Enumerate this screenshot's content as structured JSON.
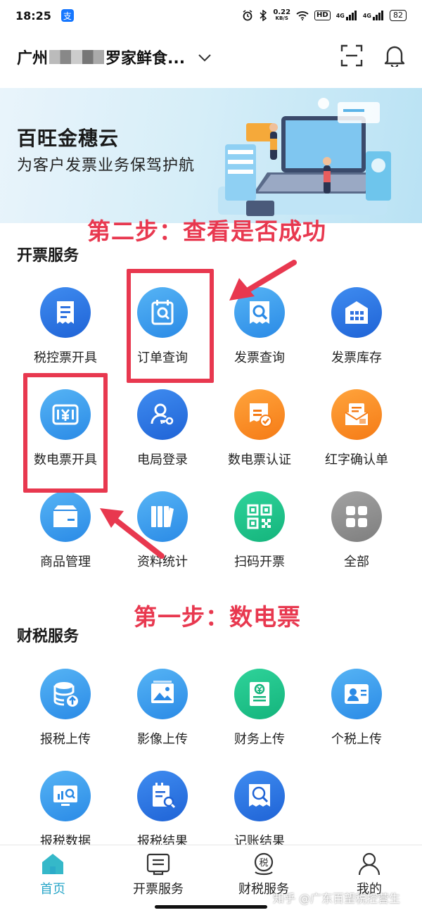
{
  "status_bar": {
    "time": "18:25",
    "app_badge": "支",
    "speed_value": "0.22",
    "speed_unit": "KB/S",
    "hd": "HD",
    "signal1": "4G",
    "signal2": "4G",
    "battery": "82"
  },
  "header": {
    "company_prefix": "广州",
    "company_suffix": "罗家鲜食...",
    "icons": [
      "chevron-down-icon",
      "scan-icon",
      "bell-icon"
    ]
  },
  "banner": {
    "title": "百旺金穗云",
    "subtitle": "为客户发票业务保驾护航"
  },
  "annotations": {
    "step2": "第二步：查看是否成功",
    "step1": "第一步：数电票",
    "color": "#e8384f"
  },
  "invoice_services": {
    "title": "开票服务",
    "items": [
      {
        "label": "税控票开具",
        "icon": "receipt-icon"
      },
      {
        "label": "订单查询",
        "icon": "order-search-icon"
      },
      {
        "label": "发票查询",
        "icon": "invoice-search-icon"
      },
      {
        "label": "发票库存",
        "icon": "inventory-icon"
      },
      {
        "label": "数电票开具",
        "icon": "yuan-invoice-icon"
      },
      {
        "label": "电局登录",
        "icon": "login-key-icon"
      },
      {
        "label": "数电票认证",
        "icon": "certify-icon"
      },
      {
        "label": "红字确认单",
        "icon": "red-envelope-icon"
      },
      {
        "label": "商品管理",
        "icon": "box-icon"
      },
      {
        "label": "资料统计",
        "icon": "books-icon"
      },
      {
        "label": "扫码开票",
        "icon": "qr-code-icon"
      },
      {
        "label": "全部",
        "icon": "grid-icon"
      }
    ]
  },
  "tax_services": {
    "title": "财税服务",
    "items": [
      {
        "label": "报税上传",
        "icon": "database-upload-icon"
      },
      {
        "label": "影像上传",
        "icon": "image-upload-icon"
      },
      {
        "label": "财务上传",
        "icon": "finance-doc-icon"
      },
      {
        "label": "个税上传",
        "icon": "id-card-icon"
      },
      {
        "label": "报税数据",
        "icon": "monitor-chart-icon"
      },
      {
        "label": "报税结果",
        "icon": "result-doc-icon"
      },
      {
        "label": "记账结果",
        "icon": "ledger-icon"
      }
    ]
  },
  "bottom_nav": {
    "items": [
      {
        "label": "首页",
        "icon": "home-icon",
        "active": true
      },
      {
        "label": "开票服务",
        "icon": "invoice-icon",
        "active": false
      },
      {
        "label": "财税服务",
        "icon": "tax-icon",
        "active": false
      },
      {
        "label": "我的",
        "icon": "user-icon",
        "active": false
      }
    ],
    "active_color": "#2aa7c9"
  },
  "watermark": "知乎 @广东百望税控营生"
}
